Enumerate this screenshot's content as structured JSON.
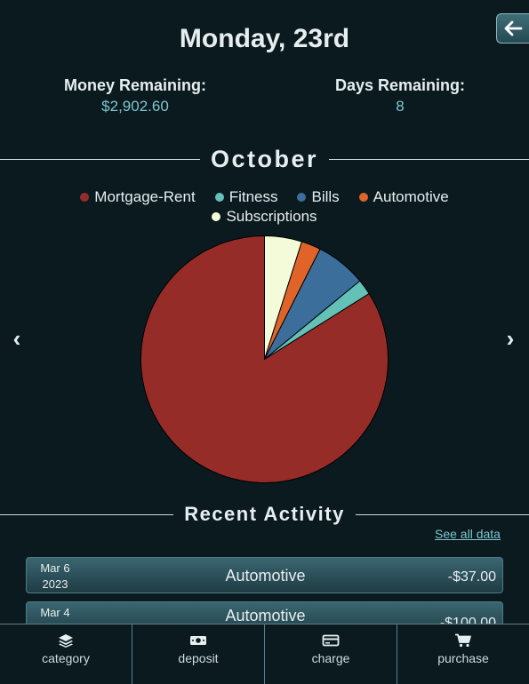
{
  "header": {
    "title": "Monday, 23rd",
    "back_icon": "arrow-left-icon"
  },
  "stats": {
    "money_label": "Money Remaining:",
    "money_value": "$2,902.60",
    "days_label": "Days Remaining:",
    "days_value": "8"
  },
  "month": "October",
  "nav": {
    "prev_glyph": "‹",
    "next_glyph": "›"
  },
  "chart_data": {
    "type": "pie",
    "title": "",
    "legend_position": "top",
    "categories": [
      "Mortgage-Rent",
      "Fitness",
      "Bills",
      "Automotive",
      "Subscriptions"
    ],
    "values": [
      82.5,
      2.0,
      6.5,
      2.5,
      4.8
    ],
    "colors": [
      "#962c28",
      "#63c1b8",
      "#3c6e9c",
      "#e0642a",
      "#f4fbd8"
    ]
  },
  "activity": {
    "title": "Recent Activity",
    "see_all": "See all data",
    "items": [
      {
        "date": "Mar 6",
        "year": "2023",
        "category": "Automotive",
        "amount": "-$37.00"
      },
      {
        "date": "Mar 4",
        "year": "",
        "category": "Automotive",
        "amount": "-$100.00"
      }
    ]
  },
  "bottom_nav": {
    "tabs": [
      {
        "label": "category",
        "icon": "layers-icon"
      },
      {
        "label": "deposit",
        "icon": "money-bill-icon"
      },
      {
        "label": "charge",
        "icon": "credit-card-icon"
      },
      {
        "label": "purchase",
        "icon": "shopping-cart-icon"
      }
    ]
  }
}
